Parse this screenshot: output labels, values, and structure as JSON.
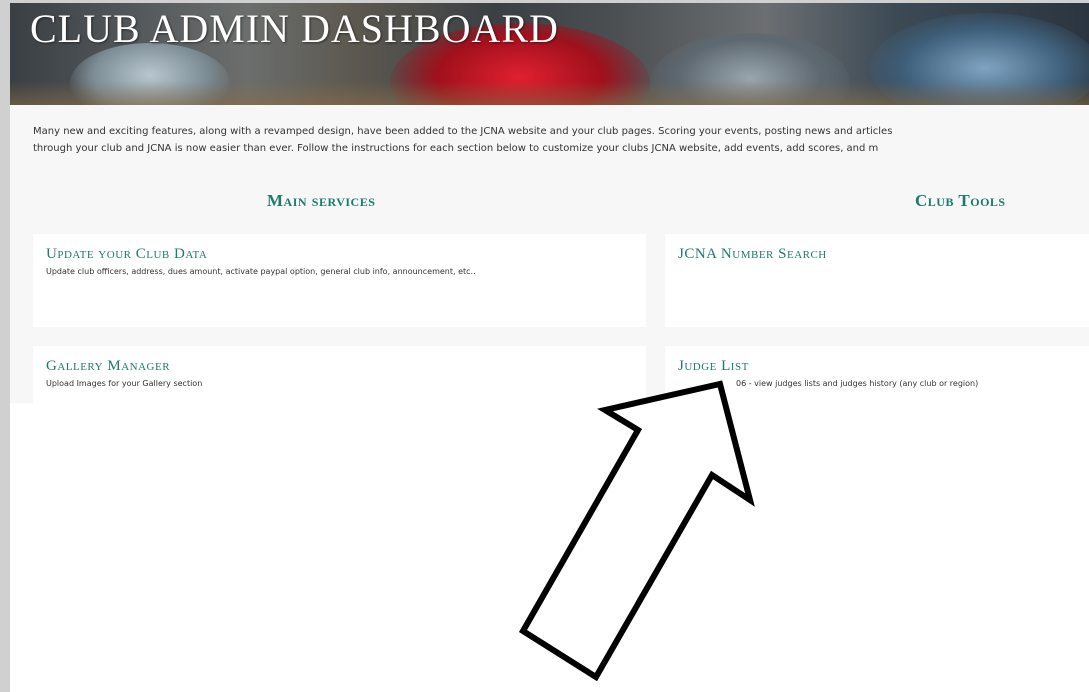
{
  "header": {
    "title": "CLUB ADMIN DASHBOARD"
  },
  "intro": {
    "line1": "Many new and exciting features, along with a revamped design, have been added to the JCNA website and your club pages. Scoring your events, posting news and articles",
    "line2": "through your club and JCNA is now easier than ever. Follow the instructions for each section below to customize your clubs JCNA website, add events, add scores, and m"
  },
  "main_services": {
    "title": "Main services",
    "cards": [
      {
        "title": "Update your Club Data",
        "desc": "Update club officers, address, dues amount, activate paypal option, general club info, announcement, etc.."
      },
      {
        "title": "Gallery Manager",
        "desc": "Upload Images for your Gallery section"
      }
    ]
  },
  "club_tools": {
    "title": "Club Tools",
    "cards": [
      {
        "title": "JCNA Number Search",
        "desc": ""
      },
      {
        "title": "Judge List",
        "desc": "06 - view judges lists and judges history (any club or region)"
      }
    ]
  },
  "colors": {
    "accent": "#1f7a6c",
    "page_bg": "#f7f7f7",
    "card_bg": "#ffffff"
  },
  "annotation": {
    "arrow_icon": "outlined-arrow-pointing-up-right"
  }
}
